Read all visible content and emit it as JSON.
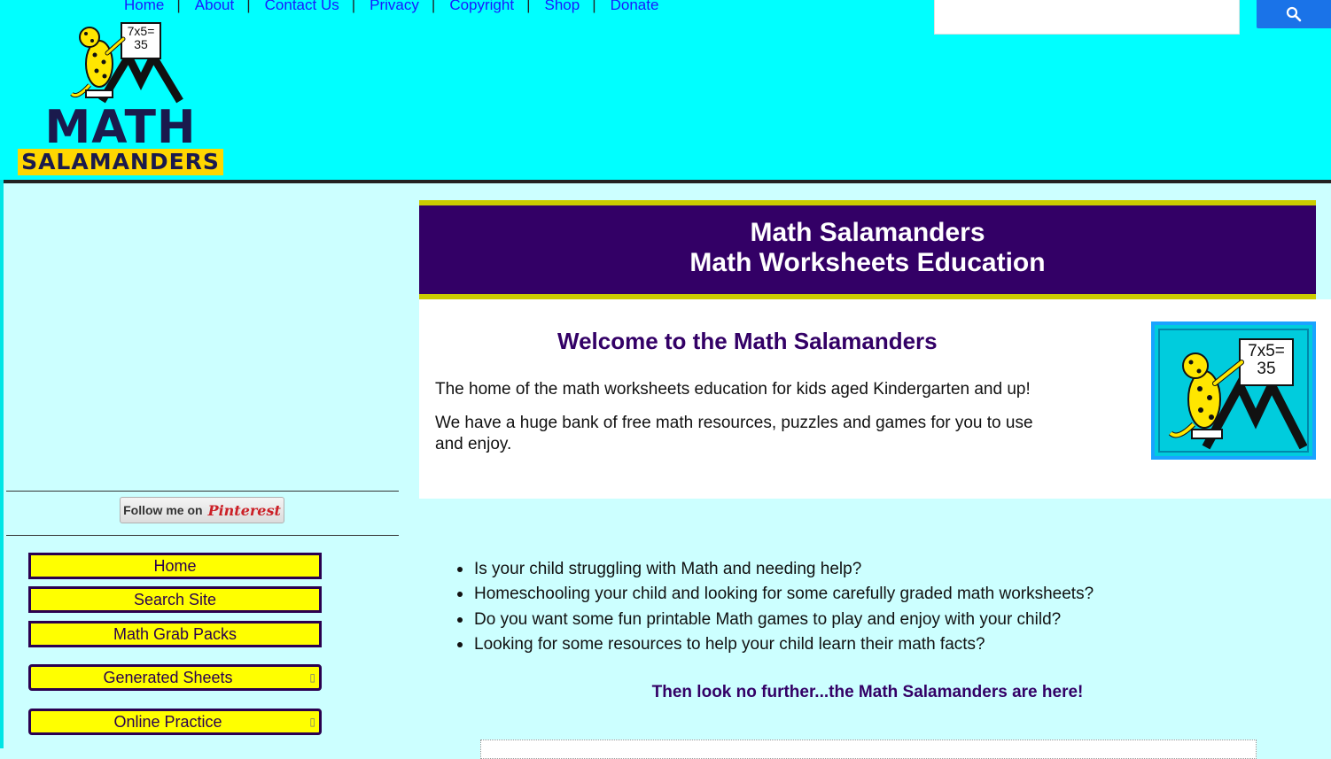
{
  "top_nav": {
    "items": [
      "Home",
      "About",
      "Contact Us",
      "Privacy",
      "Copyright",
      "Shop",
      "Donate"
    ],
    "separator": "|"
  },
  "search": {
    "placeholder": "",
    "button_icon": "search-icon"
  },
  "logo": {
    "line1": "MATH",
    "line2": "SALAMANDERS",
    "board_text": "7x5= 35"
  },
  "pinterest": {
    "label": "Follow me on",
    "brand": "Pinterest"
  },
  "sidebar": {
    "items": [
      {
        "label": "Home",
        "has_submenu": false
      },
      {
        "label": "Search Site",
        "has_submenu": false
      },
      {
        "label": "Math Grab Packs",
        "has_submenu": false
      },
      {
        "label": "Generated Sheets",
        "has_submenu": true
      },
      {
        "label": "Online Practice",
        "has_submenu": true
      }
    ],
    "submenu_arrow": "▯"
  },
  "banner": {
    "line1": "Math Salamanders",
    "line2": "Math Worksheets Education"
  },
  "welcome": {
    "title": "Welcome to the Math Salamanders",
    "p1": "The home of the math worksheets education for kids aged Kindergarten and up!",
    "p2": "We have a huge bank of free math resources, puzzles and games for you to use and enjoy.",
    "image_text": "7x5= 35"
  },
  "bullets": [
    "Is your child struggling with Math and needing help?",
    "Homeschooling your child and looking for some carefully graded math worksheets?",
    "Do you want some fun printable Math games to play and enjoy with your child?",
    "Looking for some resources to help your child learn their math facts?"
  ],
  "tagline": "Then look no further...the Math Salamanders are here!",
  "colors": {
    "header_bg": "#00ffff",
    "page_bg": "#ccffff",
    "banner_bg": "#330066",
    "banner_border": "#cccc00",
    "nav_button_bg": "#ffff00",
    "nav_button_border": "#2a004f",
    "link": "#1a1aff",
    "search_button": "#1a73e8"
  }
}
